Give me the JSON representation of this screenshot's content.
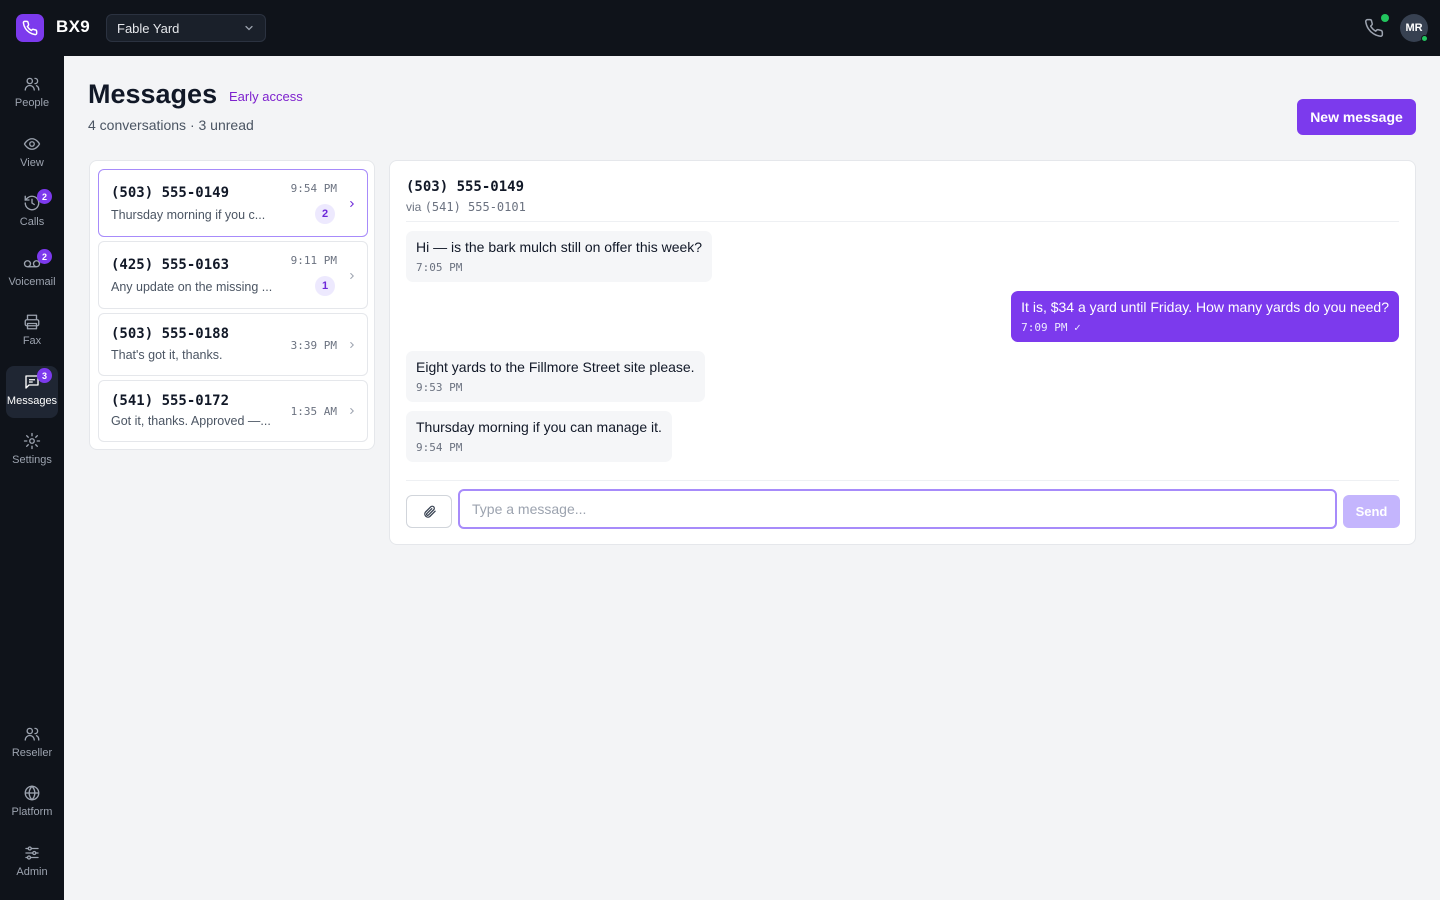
{
  "app": {
    "brand": "BX9",
    "tenant": "Fable Yard",
    "user_initials": "MR"
  },
  "sidebar": {
    "items": [
      {
        "label": "People",
        "icon": "people-icon"
      },
      {
        "label": "View",
        "icon": "eye-icon"
      },
      {
        "label": "Calls",
        "icon": "history-icon",
        "badge": "2"
      },
      {
        "label": "Voicemail",
        "icon": "voicemail-icon",
        "badge": "2"
      },
      {
        "label": "Fax",
        "icon": "printer-icon"
      },
      {
        "label": "Messages",
        "icon": "message-icon",
        "badge": "3",
        "active": true
      },
      {
        "label": "Settings",
        "icon": "gear-icon"
      }
    ],
    "bottom_items": [
      {
        "label": "Reseller",
        "icon": "people-icon"
      },
      {
        "label": "Platform",
        "icon": "globe-icon"
      },
      {
        "label": "Admin",
        "icon": "sliders-icon"
      }
    ]
  },
  "header": {
    "title": "Messages",
    "tag": "Early access",
    "subtitle": "4 conversations · 3 unread",
    "new_button": "New message"
  },
  "conversations": [
    {
      "number": "(503) 555-0149",
      "preview": "Thursday morning if you c...",
      "time": "9:54 PM",
      "unread": "2",
      "selected": true
    },
    {
      "number": "(425) 555-0163",
      "preview": "Any update on the missing ...",
      "time": "9:11 PM",
      "unread": "1"
    },
    {
      "number": "(503) 555-0188",
      "preview": "That's got it, thanks.",
      "time": "3:39 PM"
    },
    {
      "number": "(541) 555-0172",
      "preview": "Got it, thanks. Approved —...",
      "time": "1:35 AM"
    }
  ],
  "thread": {
    "number": "(503) 555-0149",
    "via_label": "via",
    "via_number": "(541) 555-0101",
    "messages": [
      {
        "dir": "in",
        "text": "Hi — is the bark mulch still on offer this week?",
        "time": "7:05 PM"
      },
      {
        "dir": "out",
        "text": "It is, $34 a yard until Friday. How many yards do you need?",
        "time": "7:09 PM ✓"
      },
      {
        "dir": "in",
        "text": "Eight yards to the Fillmore Street site please.",
        "time": "9:53 PM"
      },
      {
        "dir": "in",
        "text": "Thursday morning if you can manage it.",
        "time": "9:54 PM"
      }
    ],
    "input_placeholder": "Type a message...",
    "send_label": "Send"
  },
  "colors": {
    "accent": "#7c3aed",
    "sidebar_bg": "#0f131a",
    "online": "#22c55e"
  }
}
